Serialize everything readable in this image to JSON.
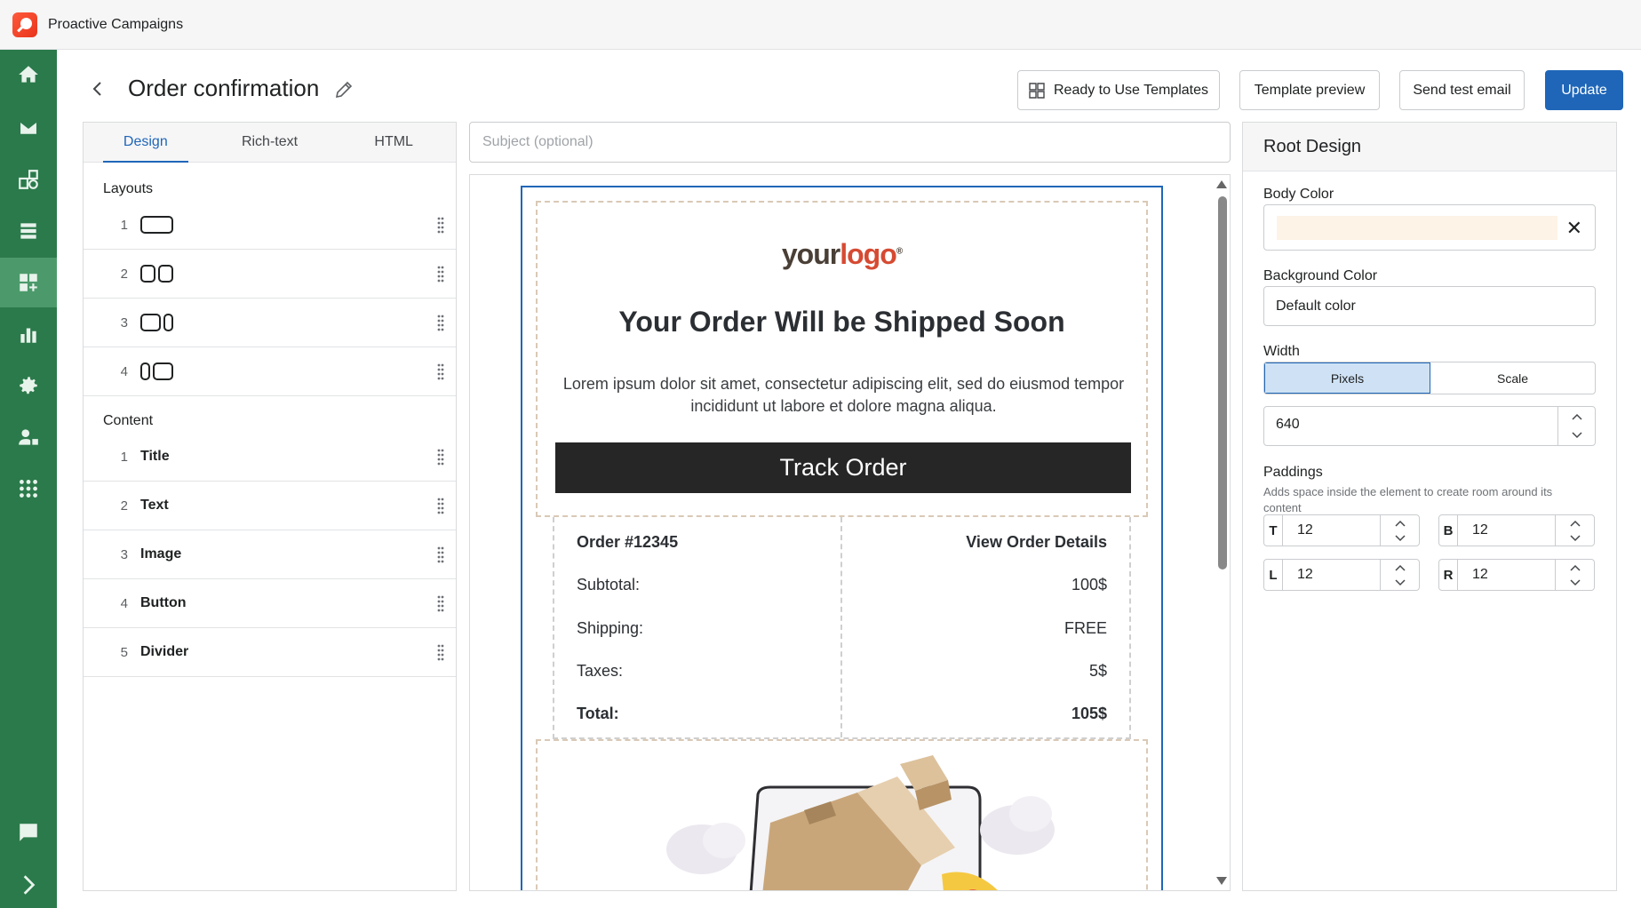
{
  "app": {
    "title": "Proactive Campaigns"
  },
  "header": {
    "title": "Order confirmation",
    "buttons": {
      "templates": "Ready to Use Templates",
      "preview": "Template preview",
      "test_email": "Send test email",
      "update": "Update"
    }
  },
  "sidebar": {
    "items": [
      "home-icon",
      "mail-icon",
      "shapes-icon",
      "layers-icon",
      "add-widget-icon",
      "bar-chart-icon",
      "gear-icon",
      "user-lock-icon",
      "apps-grid-icon",
      "chat-icon",
      "chevron-right-icon"
    ],
    "active_index": 4
  },
  "left_panel": {
    "tabs": [
      "Design",
      "Rich-text",
      "HTML"
    ],
    "active_tab": "Design",
    "layouts_label": "Layouts",
    "layouts": [
      {
        "num": "1"
      },
      {
        "num": "2"
      },
      {
        "num": "3"
      },
      {
        "num": "4"
      }
    ],
    "content_label": "Content",
    "content": [
      {
        "num": "1",
        "label": "Title"
      },
      {
        "num": "2",
        "label": "Text"
      },
      {
        "num": "3",
        "label": "Image"
      },
      {
        "num": "4",
        "label": "Button"
      },
      {
        "num": "5",
        "label": "Divider"
      }
    ]
  },
  "subject": {
    "placeholder": "Subject (optional)"
  },
  "email": {
    "logo_your": "your",
    "logo_logo": "logo",
    "logo_reg": "®",
    "title": "Your Order Will be Shipped Soon",
    "text": "Lorem ipsum dolor sit amet, consectetur adipiscing elit, sed do eiusmod tempor incididunt ut labore et dolore magna aliqua.",
    "button": "Track Order",
    "order": {
      "number": "Order #12345",
      "details_link": "View Order Details",
      "rows": [
        {
          "label": "Subtotal:",
          "value": "100$"
        },
        {
          "label": "Shipping:",
          "value": "FREE"
        },
        {
          "label": "Taxes:",
          "value": "5$"
        },
        {
          "label": "Total:",
          "value": "105$"
        }
      ]
    },
    "body_color": "#fef6ec"
  },
  "right_panel": {
    "title": "Root Design",
    "body_color_label": "Body Color",
    "body_color_value": "#fdf3e6",
    "bg_color_label": "Background Color",
    "bg_color_value": "Default color",
    "width_label": "Width",
    "width_modes": [
      "Pixels",
      "Scale"
    ],
    "width_mode_active": "Pixels",
    "width_value": "640",
    "paddings_label": "Paddings",
    "paddings_hint": "Adds space inside the element to create room around its content",
    "paddings": {
      "T": "12",
      "B": "12",
      "L": "12",
      "R": "12"
    }
  },
  "colors": {
    "primary": "#1f66b8",
    "sidebar": "#2b7a4b",
    "sidebar_active": "#4c9a6b"
  }
}
